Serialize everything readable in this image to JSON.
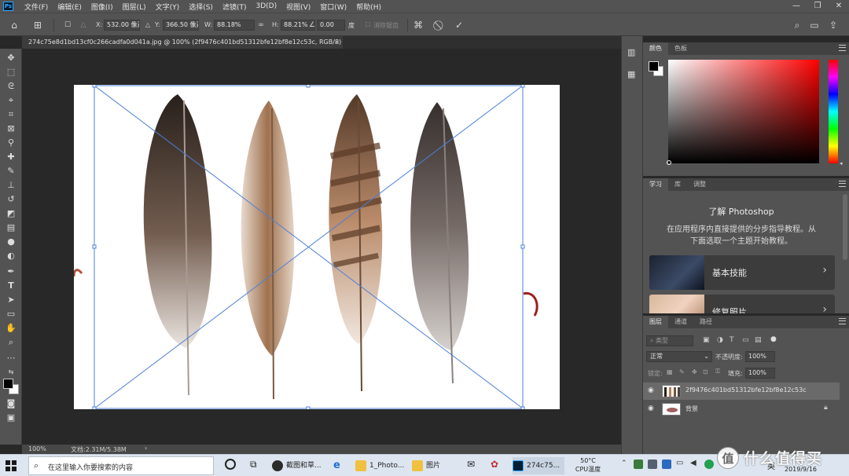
{
  "menubar": {
    "logo": "Ps",
    "items": [
      "文件(F)",
      "编辑(E)",
      "图像(I)",
      "图层(L)",
      "文字(Y)",
      "选择(S)",
      "滤镜(T)",
      "3D(D)",
      "视图(V)",
      "窗口(W)",
      "帮助(H)"
    ]
  },
  "options": {
    "x_label": "X:",
    "x_value": "532.00 像素",
    "y_label": "Y:",
    "y_value": "366.50 像素",
    "w_label": "W:",
    "w_value": "88.18%",
    "h_label": "H:",
    "h_value": "88.21%",
    "angle_value": "0.00",
    "angle_unit": "度",
    "antialias_label": "消除锯齿"
  },
  "document": {
    "tab_title": "274c75e8d1bd13cf0c266cadfa0d041a.jpg @ 100% (2f9476c401bd51312bfe12bf8e12c53c, RGB/8)",
    "zoom": "100%",
    "doc_info": "文档:2.31M/5.38M"
  },
  "color_panel": {
    "tabs": [
      "颜色",
      "色板"
    ],
    "hue_colors": [
      "#ff0000",
      "#ff00ff",
      "#0000ff",
      "#00ffff",
      "#00ff00",
      "#ffff00",
      "#ff0000"
    ]
  },
  "learn_panel": {
    "tabs": [
      "学习",
      "库",
      "调整"
    ],
    "heading": "了解 Photoshop",
    "description_line1": "在应用程序内直接提供的分步指导教程。从",
    "description_line2": "下面选取一个主题开始教程。",
    "cards": [
      {
        "label": "基本技能"
      },
      {
        "label": "修复照片"
      }
    ]
  },
  "layers_panel": {
    "tabs": [
      "图层",
      "通道",
      "路径"
    ],
    "filter_placeholder": "类型",
    "blend_mode": "正常",
    "opacity_label": "不透明度:",
    "opacity_value": "100%",
    "lock_label": "锁定:",
    "fill_label": "填充:",
    "fill_value": "100%",
    "layers": [
      {
        "name": "2f9476c401bd51312bfe12bf8e12c53c",
        "visible": true,
        "selected": true
      },
      {
        "name": "背景",
        "visible": true,
        "selected": false,
        "locked": true
      }
    ]
  },
  "taskbar": {
    "search_placeholder": "在这里输入你要搜索的内容",
    "apps": [
      {
        "label": "截图和草..."
      },
      {
        "label": "1_Photo..."
      },
      {
        "label": "图片"
      },
      {
        "label": "274c75..."
      }
    ],
    "weather_temp": "50°C",
    "weather_label": "CPU温度",
    "ime": "英",
    "date": "2019/9/16",
    "watermark": "值 什么值得买"
  }
}
